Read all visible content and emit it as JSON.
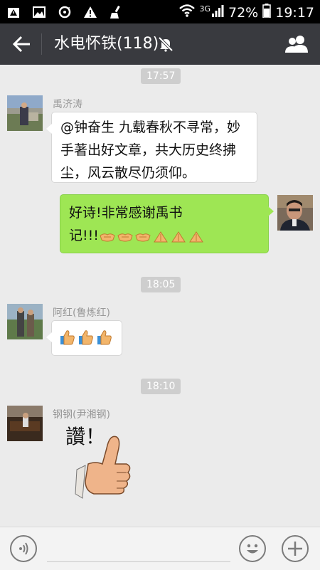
{
  "status_bar": {
    "network": "3G",
    "battery": "72%",
    "time": "19:17"
  },
  "header": {
    "title": "水电怀铁(118)"
  },
  "timestamps": [
    "17:57",
    "18:05",
    "18:10"
  ],
  "messages": [
    {
      "sender": "禹济涛",
      "text_line1": "@钟奋生 九载春秋不寻常，妙",
      "text_line2": "手著出好文章，共大历史终拂",
      "text_line3": "尘，风云散尽仍须仰。"
    },
    {
      "sender": "",
      "text_line1": "好诗!非常感谢禹书",
      "text_line2": "记!!!"
    },
    {
      "sender": "阿红(鲁炼红)"
    },
    {
      "sender": "钢钢(尹湘钢)",
      "sticker_text": "讚！"
    }
  ]
}
